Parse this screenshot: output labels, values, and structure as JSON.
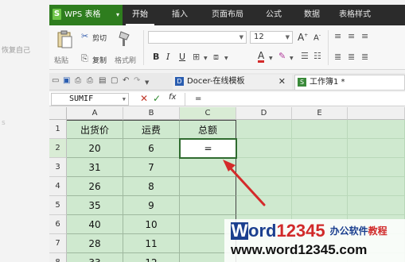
{
  "left_panel": {
    "ghost_text": "恢复自己",
    "ghost_text2": "s"
  },
  "app": {
    "name": "WPS 表格",
    "logo": "S",
    "menu_caret": "▾"
  },
  "tabs": [
    "开始",
    "插入",
    "页面布局",
    "公式",
    "数据",
    "表格样式"
  ],
  "active_tab": "开始",
  "toolbar": {
    "paste": "粘贴",
    "cut": "剪切",
    "copy": "复制",
    "format_painter": "格式刷",
    "font_name": "",
    "font_size": "12",
    "bold": "B",
    "italic": "I",
    "underline": "U",
    "font_color": "A",
    "grow": "A",
    "shrink": "A"
  },
  "doc_tabs": [
    {
      "label": "Docer-在线模板",
      "close": "✕",
      "icon": "D"
    },
    {
      "label": "工作簿1 *",
      "icon": "S"
    }
  ],
  "formula_bar": {
    "name_box": "SUMIF",
    "cancel": "✕",
    "enter": "✓",
    "fx": "fx",
    "content": "="
  },
  "columns": [
    "A",
    "B",
    "C",
    "D",
    "E"
  ],
  "rows": [
    "1",
    "2",
    "3",
    "4",
    "5",
    "6",
    "7",
    "8"
  ],
  "table": {
    "headers": [
      "出货价",
      "运费",
      "总额"
    ],
    "rows": [
      [
        "20",
        "6",
        "="
      ],
      [
        "31",
        "7",
        ""
      ],
      [
        "26",
        "8",
        ""
      ],
      [
        "35",
        "9",
        ""
      ],
      [
        "40",
        "10",
        ""
      ],
      [
        "28",
        "11",
        ""
      ],
      [
        "33",
        "12",
        ""
      ]
    ]
  },
  "selected_cell": "C2",
  "watermark": {
    "w": "W",
    "ord": "ord",
    "num": "12345",
    "tag": "办公软件",
    "tag2": "教程",
    "url": "www.word12345.com"
  },
  "colors": {
    "ribbon_dark": "#2b2b2b",
    "app_green": "#2e7d1e",
    "grid_green": "#cfe9cf",
    "arrow_red": "#d42a2a"
  }
}
